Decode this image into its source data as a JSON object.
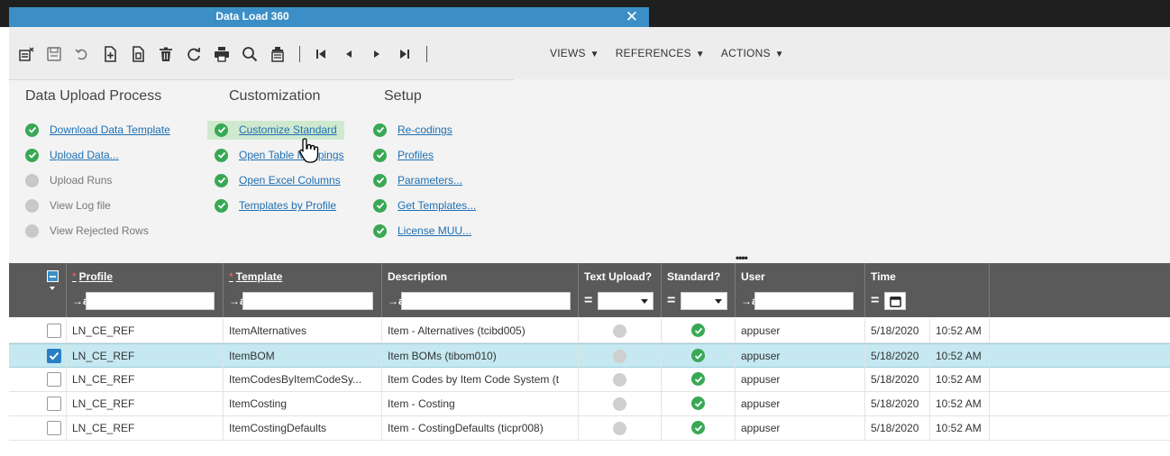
{
  "window": {
    "title": "Data Load 360",
    "close_glyph": "✕"
  },
  "toolbar": {
    "icons": [
      "new-record-icon",
      "save-icon",
      "undo-icon",
      "new-icon",
      "duplicate-icon",
      "delete-icon",
      "refresh-icon",
      "print-icon",
      "find-icon",
      "filter-icon"
    ],
    "nav_icons": [
      "first-record-icon",
      "previous-record-icon",
      "next-record-icon",
      "last-record-icon"
    ],
    "menus": [
      {
        "label": "VIEWS",
        "caret": "▼"
      },
      {
        "label": "REFERENCES",
        "caret": "▼"
      },
      {
        "label": "ACTIONS",
        "caret": "▼"
      }
    ]
  },
  "panel": {
    "columns": [
      {
        "title": "Data Upload Process",
        "items": [
          {
            "label": "Download Data Template",
            "enabled": true
          },
          {
            "label": "Upload Data...",
            "enabled": true
          },
          {
            "label": "Upload Runs",
            "enabled": false
          },
          {
            "label": "View Log file",
            "enabled": false
          },
          {
            "label": "View Rejected Rows",
            "enabled": false
          }
        ]
      },
      {
        "title": "Customization",
        "items": [
          {
            "label": "Customize Standard",
            "enabled": true,
            "hover": true
          },
          {
            "label": "Open Table Mappings",
            "enabled": true
          },
          {
            "label": "Open Excel Columns",
            "enabled": true
          },
          {
            "label": "Templates by Profile",
            "enabled": true
          }
        ]
      },
      {
        "title": "Setup",
        "items": [
          {
            "label": "Re-codings",
            "enabled": true
          },
          {
            "label": "Profiles",
            "enabled": true
          },
          {
            "label": "Parameters...",
            "enabled": true
          },
          {
            "label": "Get Templates...",
            "enabled": true
          },
          {
            "label": "License MUU...",
            "enabled": true
          }
        ]
      }
    ],
    "splitter_glyph": "••••"
  },
  "grid": {
    "columns": {
      "profile": {
        "label": "Profile",
        "required": "*",
        "filter_op": "→a"
      },
      "template": {
        "label": "Template",
        "required": "*",
        "filter_op": "→a"
      },
      "description": {
        "label": "Description",
        "filter_op": "→a"
      },
      "text_upload": {
        "label": "Text Upload?",
        "filter_op": "="
      },
      "standard": {
        "label": "Standard?",
        "filter_op": "="
      },
      "user": {
        "label": "User",
        "filter_op": "→a"
      },
      "time": {
        "label": "Time",
        "filter_op": "="
      }
    },
    "rows": [
      {
        "selected": false,
        "profile": "LN_CE_REF",
        "template": "ItemAlternatives",
        "description": "Item - Alternatives (tcibd005)",
        "text_upload": false,
        "standard": true,
        "user": "appuser",
        "date": "5/18/2020",
        "time": "10:52 AM"
      },
      {
        "selected": true,
        "profile": "LN_CE_REF",
        "template": "ItemBOM",
        "description": "Item BOMs (tibom010)",
        "text_upload": false,
        "standard": true,
        "user": "appuser",
        "date": "5/18/2020",
        "time": "10:52 AM"
      },
      {
        "selected": false,
        "profile": "LN_CE_REF",
        "template": "ItemCodesByItemCodeSy...",
        "description": "Item Codes by Item Code System (t",
        "text_upload": false,
        "standard": true,
        "user": "appuser",
        "date": "5/18/2020",
        "time": "10:52 AM"
      },
      {
        "selected": false,
        "profile": "LN_CE_REF",
        "template": "ItemCosting",
        "description": "Item - Costing",
        "text_upload": false,
        "standard": true,
        "user": "appuser",
        "date": "5/18/2020",
        "time": "10:52 AM"
      },
      {
        "selected": false,
        "profile": "LN_CE_REF",
        "template": "ItemCostingDefaults",
        "description": "Item - CostingDefaults  (ticpr008)",
        "text_upload": false,
        "standard": true,
        "user": "appuser",
        "date": "5/18/2020",
        "time": "10:52 AM"
      }
    ]
  },
  "colors": {
    "accent": "#3b8fc6",
    "ok": "#39a855",
    "link": "#1f6fb2",
    "selected_row": "#c5e8f1",
    "header": "#5a5a5a"
  }
}
